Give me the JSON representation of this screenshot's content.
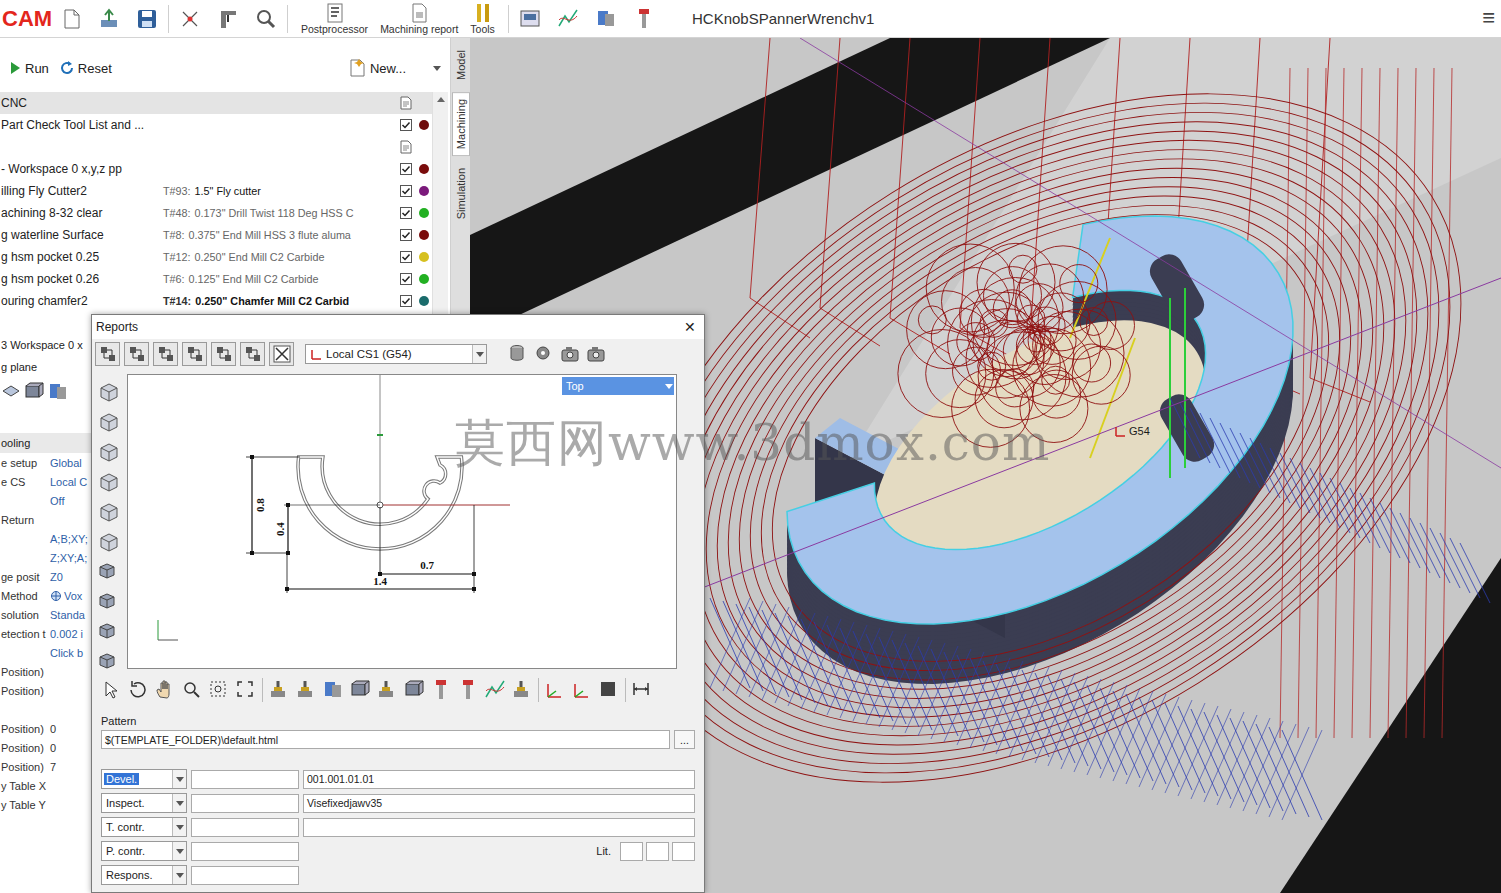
{
  "app": {
    "logo": "CAM",
    "title": "HCKnobSPannerWrenchv1",
    "menu": "≡"
  },
  "toolbar": {
    "items": [
      {
        "label": "Postprocessor"
      },
      {
        "label": "Machining report"
      },
      {
        "label": "Tools"
      }
    ]
  },
  "ops_bar": {
    "run": "Run",
    "reset": "Reset",
    "new": "New..."
  },
  "side_tabs": [
    {
      "label": "Model",
      "selected": false
    },
    {
      "label": "Machining",
      "selected": true
    },
    {
      "label": "Simulation",
      "selected": false
    }
  ],
  "tree": {
    "header": "CNC",
    "rows": [
      {
        "kind": "op",
        "name": "Part Check Tool List and ...",
        "checked": true,
        "color": "#6e0b0b"
      },
      {
        "kind": "note"
      },
      {
        "kind": "op",
        "name": "- Workspace 0 x,y,z pp",
        "checked": true,
        "color": "#7a0c0c"
      },
      {
        "kind": "op",
        "name": "illing Fly Cutter2",
        "checked": true,
        "color": "#7b1a7b",
        "tool": {
          "id": "T#93:",
          "desc": "1.5\" Fly cutter",
          "desc_dark": true,
          "bold": false
        }
      },
      {
        "kind": "op",
        "name": "achining 8-32 clear",
        "checked": true,
        "color": "#22b022",
        "tool": {
          "id": "T#48:",
          "desc": "0.173\" Drill Twist 118 Deg HSS C",
          "desc_dark": false,
          "bold": false
        }
      },
      {
        "kind": "op",
        "name": "g waterline Surface",
        "checked": true,
        "color": "#7a0c0c",
        "tool": {
          "id": "T#8:",
          "desc": "0.375\" End Mill HSS 3 flute aluma",
          "desc_dark": false,
          "bold": false
        }
      },
      {
        "kind": "op",
        "name": "g hsm pocket 0.25",
        "checked": true,
        "color": "#d6c020",
        "tool": {
          "id": "T#12:",
          "desc": "0.250\" End Mill C2 Carbide",
          "desc_dark": false,
          "bold": false
        }
      },
      {
        "kind": "op",
        "name": "g hsm pocket 0.26",
        "checked": true,
        "color": "#22b022",
        "tool": {
          "id": "T#6:",
          "desc": "0.125\" End Mill C2 Carbide",
          "desc_dark": false,
          "bold": false
        }
      },
      {
        "kind": "op",
        "name": "ouring chamfer2",
        "checked": true,
        "color": "#1a6b6b",
        "tool": {
          "id": "T#14:",
          "desc": "0.250\" Chamfer Mill C2 Carbid",
          "desc_dark": true,
          "bold": true
        }
      }
    ]
  },
  "lower": {
    "workspace": "3 Workspace 0 x",
    "plane": "g plane",
    "section": "ooling",
    "props": [
      {
        "label": "e setup",
        "value": "Global",
        "color": "#2f5fa8",
        "kind": "plain"
      },
      {
        "label": "e CS",
        "value": "Local C",
        "color": "#2f5fa8",
        "kind": "plain"
      },
      {
        "label": "",
        "value": "Off",
        "color": "#2f5fa8",
        "kind": "plain"
      },
      {
        "label": "Return",
        "value": "",
        "color": "#2f5fa8",
        "kind": "plain"
      },
      {
        "label": "",
        "value": "A;B;XY;",
        "color": "#2f5fa8",
        "kind": "plain"
      },
      {
        "label": "",
        "value": "Z;XY;A;",
        "color": "#2f5fa8",
        "kind": "plain"
      },
      {
        "label": "ge posit",
        "value": "Z0",
        "color": "#2f5fa8",
        "kind": "plain"
      },
      {
        "label": "Method",
        "value": "Vox",
        "color": "#2f5fa8",
        "kind": "iconic"
      },
      {
        "label": "solution",
        "value": "Standa",
        "color": "#2f5fa8",
        "kind": "plain"
      },
      {
        "label": "etection t",
        "value": "0.002 i",
        "color": "#2f5fa8",
        "kind": "plain"
      },
      {
        "label": "",
        "value": "Click b",
        "color": "#2f5fa8",
        "kind": "plain"
      },
      {
        "label": "Position)",
        "value": "",
        "color": "#333333",
        "kind": "plain"
      },
      {
        "label": "Position)",
        "value": "",
        "color": "#333333",
        "kind": "plain"
      },
      {
        "label": "",
        "value": "",
        "color": "#333333",
        "kind": "plain"
      },
      {
        "label": "Position)",
        "value": "0",
        "color": "#333333",
        "kind": "plain"
      },
      {
        "label": "Position)",
        "value": "0",
        "color": "#333333",
        "kind": "plain"
      },
      {
        "label": "Position)",
        "value": "7",
        "color": "#333333",
        "kind": "plain"
      },
      {
        "label": "y Table X",
        "value": "",
        "color": "#333333",
        "kind": "plain"
      },
      {
        "label": "y Table Y",
        "value": "",
        "color": "#333333",
        "kind": "plain"
      }
    ]
  },
  "reports": {
    "title": "Reports",
    "close": "✕",
    "cs": "Local CS1 (G54)",
    "view": "Top",
    "dims": [
      {
        "label": "0.8"
      },
      {
        "label": "0.4"
      },
      {
        "label": "0.7"
      },
      {
        "label": "1.4"
      }
    ],
    "pattern_label": "Pattern",
    "pattern": "$(TEMPLATE_FOLDER)\\default.html",
    "browse": "...",
    "lit_label": "Lit.",
    "people": [
      {
        "role": "Devel.",
        "selected": true,
        "name": "",
        "value": "001.001.01.01",
        "kind": "full"
      },
      {
        "role": "Inspect.",
        "selected": false,
        "name": "",
        "value": "Visefixedjawv35",
        "kind": "full"
      },
      {
        "role": "T. contr.",
        "selected": false,
        "name": "",
        "value": "",
        "kind": "full"
      },
      {
        "role": "P. contr.",
        "selected": false,
        "name": "",
        "kind": "lit"
      },
      {
        "role": "Respons.",
        "selected": false,
        "name": "",
        "kind": "short"
      }
    ]
  },
  "viewport": {
    "cs_label": "G54"
  },
  "watermark": "莫西网www.3dmox.com"
}
